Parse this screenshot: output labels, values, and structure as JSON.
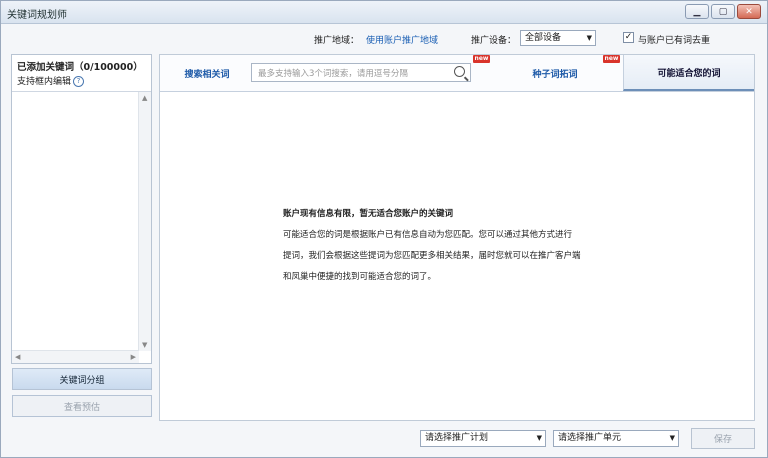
{
  "window": {
    "title": "关键词规划师"
  },
  "toprow": {
    "region_label": "推广地域：",
    "region_link": "使用账户推广地域",
    "device_label": "推广设备：",
    "device_select": "全部设备",
    "dedupe_checked": true,
    "dedupe_label": "与账户已有词去重"
  },
  "left": {
    "title": "已添加关键词（0/100000）",
    "subtitle": "支持框内编辑",
    "help_icon": "?",
    "group_button": "关键词分组",
    "estimate_button": "查看预估"
  },
  "tabs": {
    "search_related": "搜索相关词",
    "search_placeholder": "最多支持输入3个词搜索，请用逗号分隔",
    "seed_expand": "种子词拓词",
    "suitable": "可能适合您的词",
    "new_badge": "new"
  },
  "message": {
    "title": "账户现有信息有限，暂无适合您账户的关键词",
    "line1": "可能适合您的词是根据账户已有信息自动为您匹配。您可以通过其他方式进行",
    "line2": "提词，我们会根据这些提词为您匹配更多相关结果，届时您就可以在推广客户端",
    "line3": "和凤巢中便捷的找到可能适合您的词了。"
  },
  "bottom": {
    "plan_select": "请选择推广计划",
    "unit_select": "请选择推广单元",
    "save_button": "保存"
  },
  "icons": {
    "minimize": "minimize-icon",
    "maximize": "maximize-icon",
    "close": "close-icon",
    "search": "search-icon",
    "dropdown": "chevron-down-icon"
  }
}
